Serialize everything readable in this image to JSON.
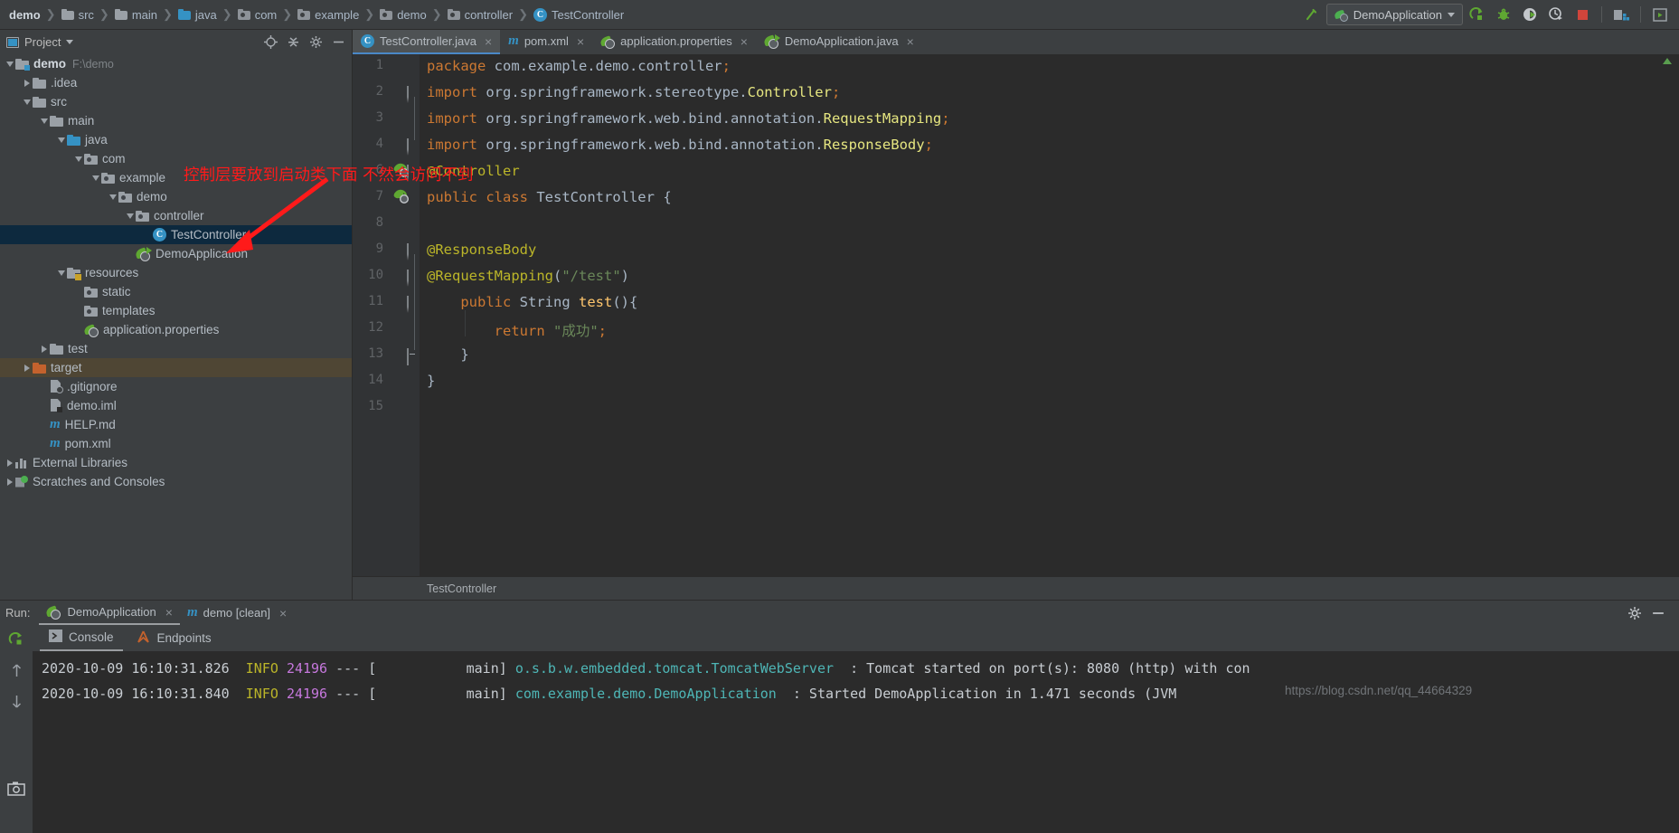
{
  "breadcrumb": [
    {
      "label": "demo",
      "icon": "none"
    },
    {
      "label": "src",
      "icon": "folder"
    },
    {
      "label": "main",
      "icon": "folder"
    },
    {
      "label": "java",
      "icon": "folder-blue"
    },
    {
      "label": "com",
      "icon": "package"
    },
    {
      "label": "example",
      "icon": "package"
    },
    {
      "label": "demo",
      "icon": "package"
    },
    {
      "label": "controller",
      "icon": "package"
    },
    {
      "label": "TestController",
      "icon": "class"
    }
  ],
  "toolbar": {
    "run_config": "DemoApplication",
    "icons": [
      "build-hammer-icon",
      "run-icon",
      "debug-icon",
      "run-with-coverage-icon",
      "profiler-icon",
      "stop-icon",
      "project-structure-icon",
      "search-everywhere-icon"
    ]
  },
  "sidebar": {
    "title": "Project",
    "header_icons": [
      "locate-icon",
      "collapse-all-icon",
      "settings-gear-icon",
      "hide-icon"
    ],
    "tree": [
      {
        "label": "demo",
        "path": "F:\\demo",
        "depth": 0,
        "arrow": "open",
        "icon": "module-folder",
        "bold": true,
        "state": "normal"
      },
      {
        "label": ".idea",
        "path": "",
        "depth": 1,
        "arrow": "closed",
        "icon": "folder",
        "bold": false,
        "state": "normal"
      },
      {
        "label": "src",
        "path": "",
        "depth": 1,
        "arrow": "open",
        "icon": "folder",
        "bold": false,
        "state": "normal"
      },
      {
        "label": "main",
        "path": "",
        "depth": 2,
        "arrow": "open",
        "icon": "folder",
        "bold": false,
        "state": "normal"
      },
      {
        "label": "java",
        "path": "",
        "depth": 3,
        "arrow": "open",
        "icon": "source-folder",
        "bold": false,
        "state": "normal"
      },
      {
        "label": "com",
        "path": "",
        "depth": 4,
        "arrow": "open",
        "icon": "package",
        "bold": false,
        "state": "normal"
      },
      {
        "label": "example",
        "path": "",
        "depth": 5,
        "arrow": "open",
        "icon": "package",
        "bold": false,
        "state": "normal"
      },
      {
        "label": "demo",
        "path": "",
        "depth": 6,
        "arrow": "open",
        "icon": "package",
        "bold": false,
        "state": "normal"
      },
      {
        "label": "controller",
        "path": "",
        "depth": 7,
        "arrow": "open",
        "icon": "package",
        "bold": false,
        "state": "normal"
      },
      {
        "label": "TestController",
        "path": "",
        "depth": 8,
        "arrow": "none",
        "icon": "java-class",
        "bold": false,
        "state": "selected"
      },
      {
        "label": "DemoApplication",
        "path": "",
        "depth": 7,
        "arrow": "none",
        "icon": "spring-boot-app",
        "bold": false,
        "state": "normal"
      },
      {
        "label": "resources",
        "path": "",
        "depth": 3,
        "arrow": "open",
        "icon": "resource-folder",
        "bold": false,
        "state": "normal"
      },
      {
        "label": "static",
        "path": "",
        "depth": 4,
        "arrow": "none",
        "icon": "package",
        "bold": false,
        "state": "normal"
      },
      {
        "label": "templates",
        "path": "",
        "depth": 4,
        "arrow": "none",
        "icon": "package",
        "bold": false,
        "state": "normal"
      },
      {
        "label": "application.properties",
        "path": "",
        "depth": 4,
        "arrow": "none",
        "icon": "spring-config",
        "bold": false,
        "state": "normal"
      },
      {
        "label": "test",
        "path": "",
        "depth": 2,
        "arrow": "closed",
        "icon": "folder",
        "bold": false,
        "state": "normal"
      },
      {
        "label": "target",
        "path": "",
        "depth": 1,
        "arrow": "closed",
        "icon": "excluded-folder",
        "bold": false,
        "state": "excluded"
      },
      {
        "label": ".gitignore",
        "path": "",
        "depth": 2,
        "arrow": "none",
        "icon": "gitignore-file",
        "bold": false,
        "state": "normal"
      },
      {
        "label": "demo.iml",
        "path": "",
        "depth": 2,
        "arrow": "none",
        "icon": "iml-file",
        "bold": false,
        "state": "normal"
      },
      {
        "label": "HELP.md",
        "path": "",
        "depth": 2,
        "arrow": "none",
        "icon": "markdown-file",
        "bold": false,
        "state": "normal"
      },
      {
        "label": "pom.xml",
        "path": "",
        "depth": 2,
        "arrow": "none",
        "icon": "maven-file",
        "bold": false,
        "state": "normal"
      },
      {
        "label": "External Libraries",
        "path": "",
        "depth": 0,
        "arrow": "closed",
        "icon": "library-icon",
        "bold": false,
        "state": "normal"
      },
      {
        "label": "Scratches and Consoles",
        "path": "",
        "depth": 0,
        "arrow": "closed",
        "icon": "scratch-icon",
        "bold": false,
        "state": "normal"
      }
    ]
  },
  "editor": {
    "tabs": [
      {
        "label": "TestController.java",
        "icon": "java-class-icon",
        "active": true
      },
      {
        "label": "pom.xml",
        "icon": "maven-icon",
        "active": false
      },
      {
        "label": "application.properties",
        "icon": "spring-icon",
        "active": false
      },
      {
        "label": "DemoApplication.java",
        "icon": "spring-boot-icon",
        "active": false
      }
    ],
    "status_text": "TestController",
    "line_numbers": [
      "1",
      "2",
      "3",
      "4",
      "6",
      "7",
      "8",
      "9",
      "10",
      "11",
      "12",
      "13",
      "14",
      "15"
    ],
    "code_lines": [
      {
        "n": 1,
        "segs": [
          {
            "t": "package ",
            "c": "kw"
          },
          {
            "t": "com.example.demo.controller",
            "c": "pl"
          },
          {
            "t": ";",
            "c": "sem"
          }
        ]
      },
      {
        "n": 2,
        "segs": [
          {
            "t": "import ",
            "c": "kw"
          },
          {
            "t": "org.springframework.stereotype.",
            "c": "pl"
          },
          {
            "t": "Controller",
            "c": "cls"
          },
          {
            "t": ";",
            "c": "sem"
          }
        ]
      },
      {
        "n": 3,
        "segs": [
          {
            "t": "import ",
            "c": "kw"
          },
          {
            "t": "org.springframework.web.bind.annotation.",
            "c": "pl"
          },
          {
            "t": "RequestMapping",
            "c": "cls"
          },
          {
            "t": ";",
            "c": "sem"
          }
        ]
      },
      {
        "n": 4,
        "segs": [
          {
            "t": "import ",
            "c": "kw"
          },
          {
            "t": "org.springframework.web.bind.annotation.",
            "c": "pl"
          },
          {
            "t": "ResponseBody",
            "c": "cls"
          },
          {
            "t": ";",
            "c": "sem"
          }
        ]
      },
      {
        "n": 6,
        "segs": [
          {
            "t": "@Controller",
            "c": "an"
          }
        ]
      },
      {
        "n": 7,
        "segs": [
          {
            "t": "public ",
            "c": "kw"
          },
          {
            "t": "class ",
            "c": "kw"
          },
          {
            "t": "TestController",
            "c": "pl"
          },
          {
            "t": " {",
            "c": "pl"
          }
        ]
      },
      {
        "n": 8,
        "segs": []
      },
      {
        "n": 9,
        "segs": [
          {
            "t": "@ResponseBody",
            "c": "an"
          }
        ]
      },
      {
        "n": 10,
        "segs": [
          {
            "t": "@RequestMapping",
            "c": "an"
          },
          {
            "t": "(",
            "c": "pl"
          },
          {
            "t": "\"/test\"",
            "c": "str"
          },
          {
            "t": ")",
            "c": "pl"
          }
        ]
      },
      {
        "n": 11,
        "segs": [
          {
            "t": "    public ",
            "c": "kw"
          },
          {
            "t": "String ",
            "c": "pl"
          },
          {
            "t": "test",
            "c": "mn"
          },
          {
            "t": "(){",
            "c": "pl"
          }
        ]
      },
      {
        "n": 12,
        "segs": [
          {
            "t": "        return ",
            "c": "kw"
          },
          {
            "t": "\"成功\"",
            "c": "str"
          },
          {
            "t": ";",
            "c": "sem"
          }
        ]
      },
      {
        "n": 13,
        "segs": [
          {
            "t": "    }",
            "c": "pl"
          }
        ]
      },
      {
        "n": 14,
        "segs": [
          {
            "t": "}",
            "c": "pl"
          }
        ]
      },
      {
        "n": 15,
        "segs": []
      }
    ]
  },
  "annotation": {
    "text": "控制层要放到启动类下面 不然会访问不到",
    "color": "#ff1a1a"
  },
  "run_panel": {
    "label": "Run:",
    "tabs": [
      {
        "label": "DemoApplication",
        "icon": "spring-boot-icon",
        "active": true
      },
      {
        "label": "demo [clean]",
        "icon": "maven-icon",
        "active": false
      }
    ],
    "subtabs": [
      {
        "label": "Console",
        "icon": "console-icon",
        "active": true
      },
      {
        "label": "Endpoints",
        "icon": "endpoints-icon",
        "active": false
      }
    ],
    "side_icons": [
      "rerun-icon",
      "scroll-up-icon",
      "scroll-down-icon",
      "camera-icon"
    ],
    "header_icons": [
      "settings-gear-icon",
      "hide-icon"
    ],
    "console_lines": [
      {
        "datetime": "2020-10-09 16:10:31.826",
        "level": "INFO",
        "pid": "24196",
        "sep": "--- [",
        "thread": "main]",
        "logger": "o.s.b.w.embedded.tomcat.TomcatWebServer",
        "colon": ":",
        "message": "Tomcat started on port(s): 8080 (http) with con"
      },
      {
        "datetime": "2020-10-09 16:10:31.840",
        "level": "INFO",
        "pid": "24196",
        "sep": "--- [",
        "thread": "main]",
        "logger": "com.example.demo.DemoApplication",
        "colon": ":",
        "message": "Started DemoApplication in 1.471 seconds (JVM"
      }
    ]
  },
  "watermark": "https://blog.csdn.net/qq_44664329"
}
